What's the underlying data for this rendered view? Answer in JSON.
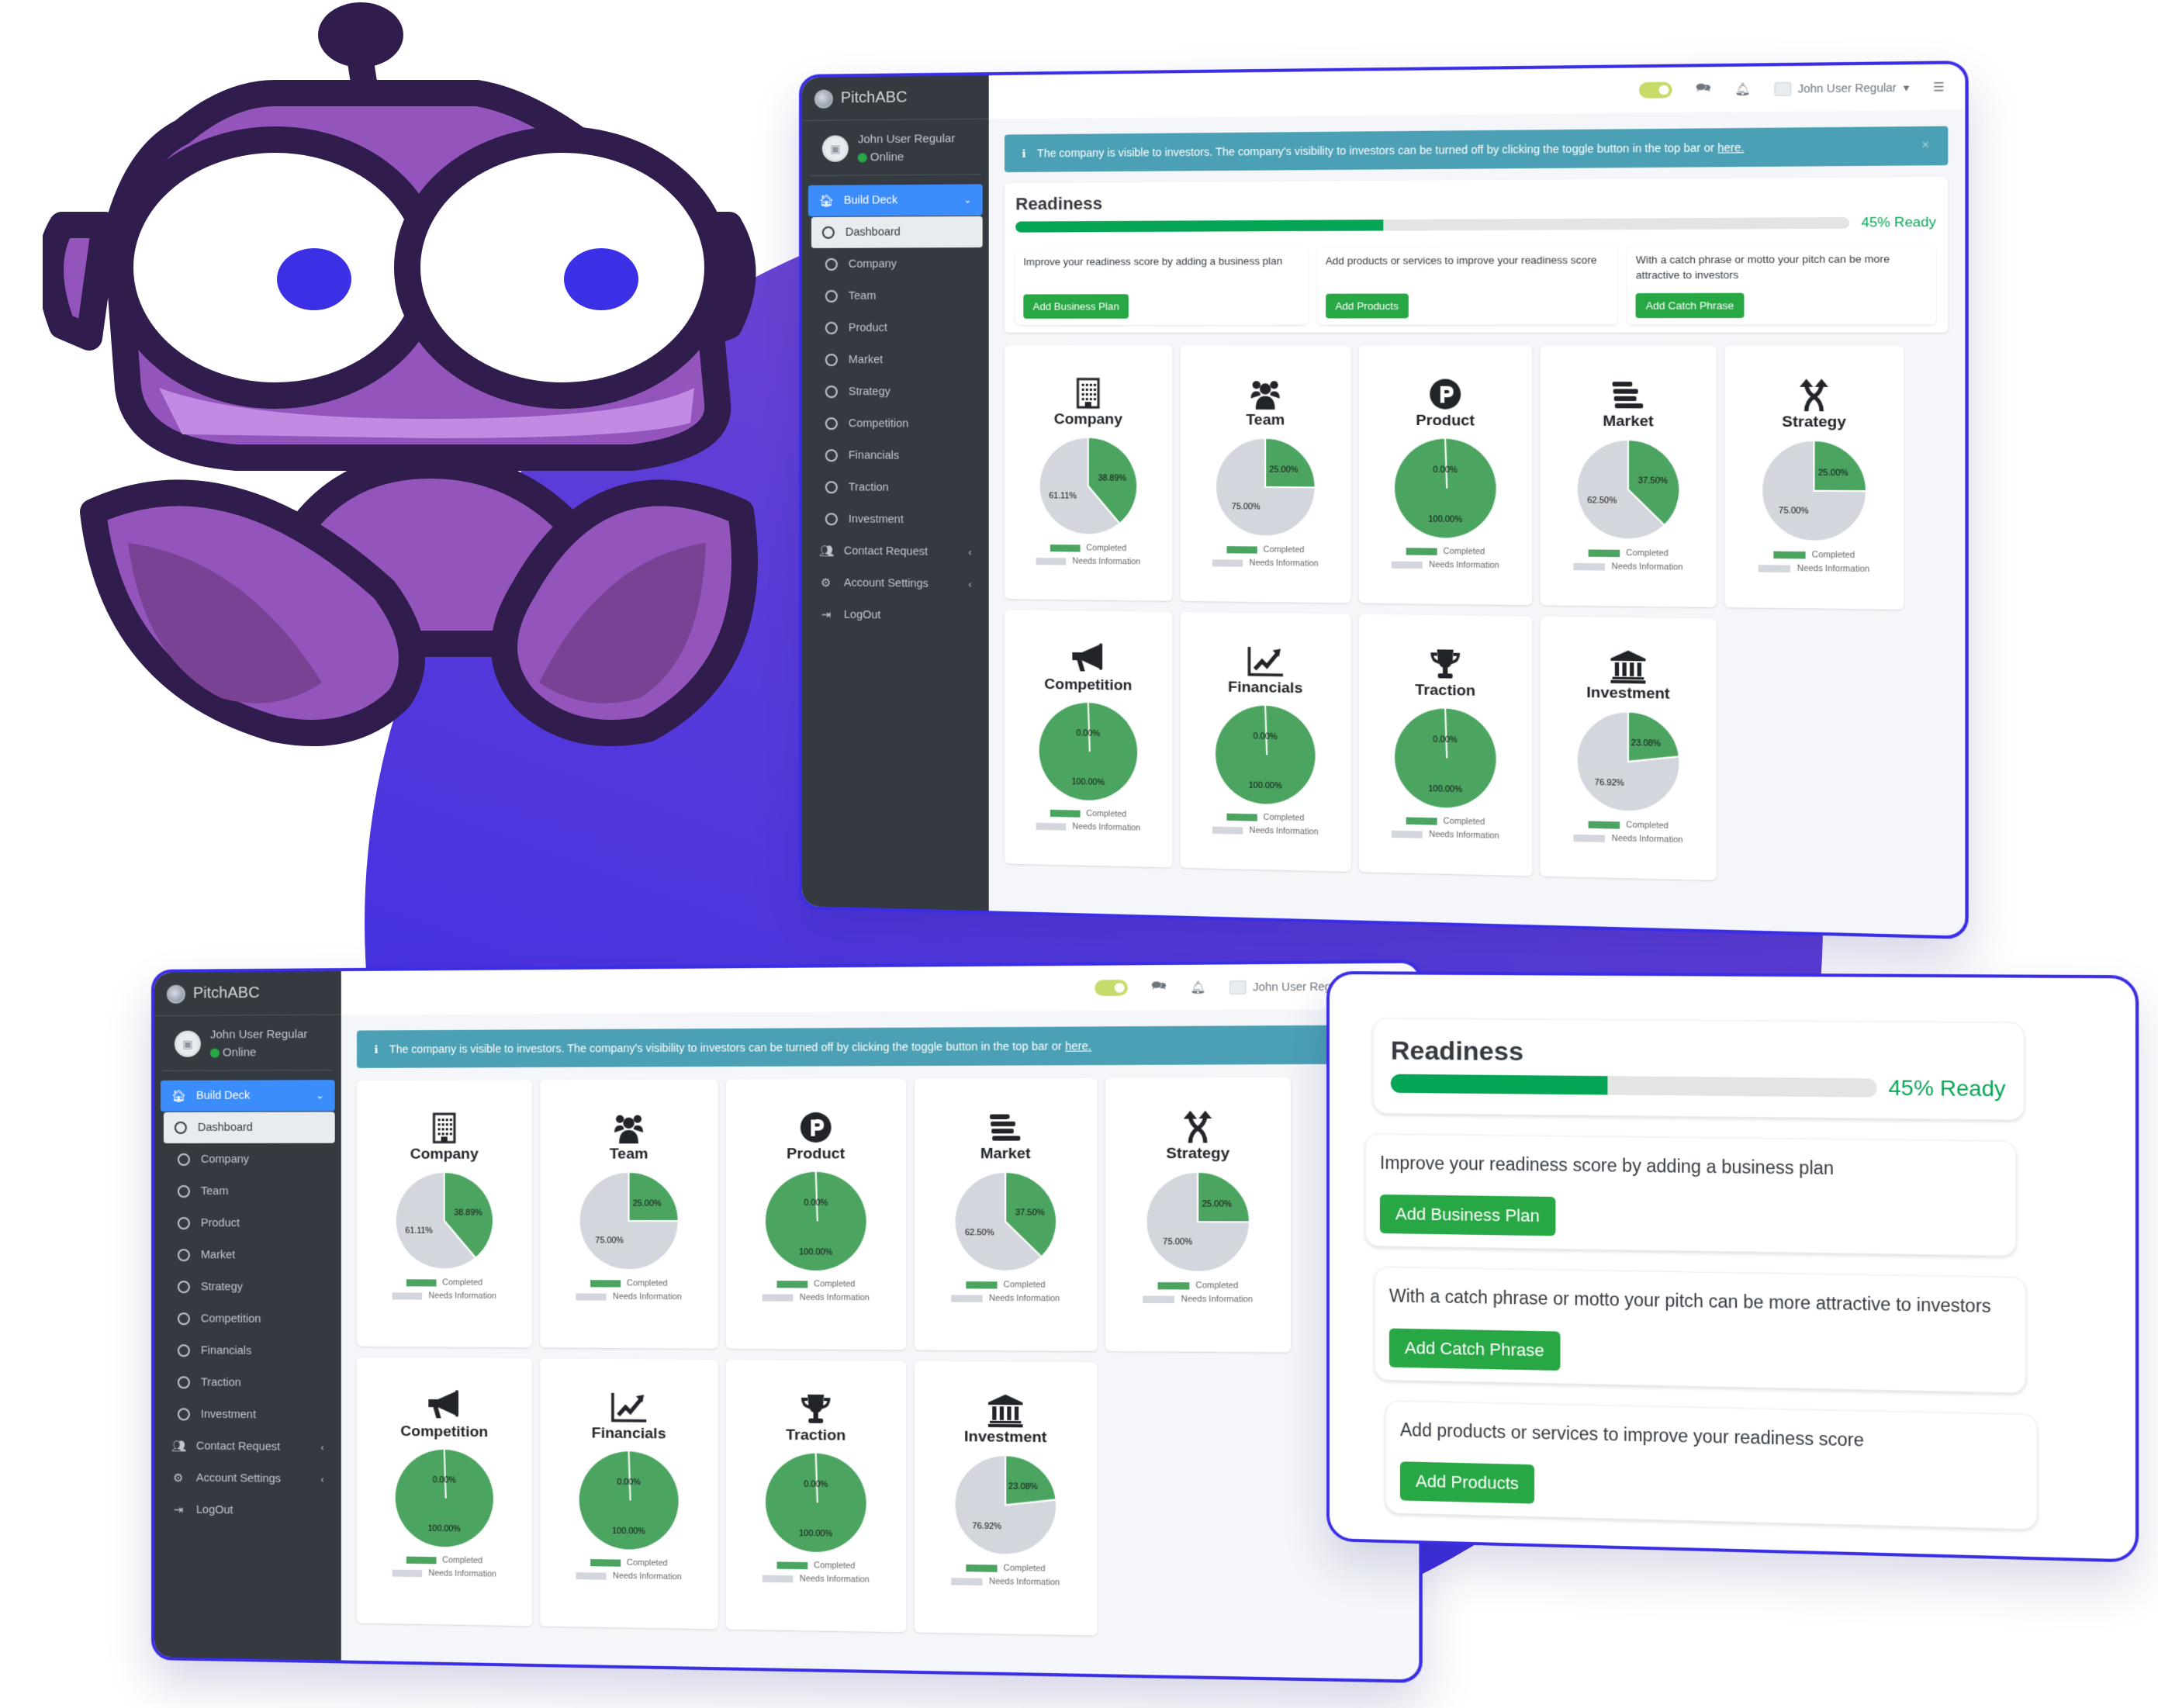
{
  "app": {
    "brand": "PitchABC",
    "user_name": "John User Regular",
    "user_status": "Online"
  },
  "topbar": {
    "visibility_toggle": "on",
    "user_menu_label": "John User Regular",
    "icons": [
      "toggle-switch-icon",
      "chat-icon",
      "bell-icon",
      "user-avatar-icon",
      "caret-down-icon",
      "hamburger-menu-icon"
    ]
  },
  "sidebar": {
    "items": [
      {
        "label": "Build Deck",
        "icon": "home-icon",
        "state": "expanded",
        "chevron": "chevron-down-icon"
      },
      {
        "label": "Dashboard",
        "icon": "circle-icon",
        "state": "current"
      },
      {
        "label": "Company",
        "icon": "circle-icon"
      },
      {
        "label": "Team",
        "icon": "circle-icon"
      },
      {
        "label": "Product",
        "icon": "circle-icon"
      },
      {
        "label": "Market",
        "icon": "circle-icon"
      },
      {
        "label": "Strategy",
        "icon": "circle-icon"
      },
      {
        "label": "Competition",
        "icon": "circle-icon"
      },
      {
        "label": "Financials",
        "icon": "circle-icon"
      },
      {
        "label": "Traction",
        "icon": "circle-icon"
      },
      {
        "label": "Investment",
        "icon": "circle-icon"
      },
      {
        "label": "Contact Request",
        "icon": "users-icon",
        "chevron": "chevron-left-icon"
      },
      {
        "label": "Account Settings",
        "icon": "cogs-icon",
        "chevron": "chevron-left-icon"
      },
      {
        "label": "LogOut",
        "icon": "sign-out-icon"
      }
    ]
  },
  "alert": {
    "icon": "info-icon",
    "text": "The company is visible to investors. The company's visibility to investors can be turned off by clicking the toggle button in the top bar or ",
    "link": "here.",
    "close": "×"
  },
  "readiness": {
    "title": "Readiness",
    "percent": 45,
    "label": "45% Ready",
    "tips": [
      {
        "text": "Improve your readiness score by adding a business plan",
        "button": "Add Business Plan"
      },
      {
        "text": "Add products or services to improve your readiness score",
        "button": "Add Products"
      },
      {
        "text": "With a catch phrase or motto your pitch can be more attractive to investors",
        "button": "Add Catch Phrase"
      }
    ],
    "panel_order": [
      0,
      2,
      1
    ]
  },
  "colors": {
    "completed": "#4ca461",
    "needs_info": "#d3d6dd",
    "accent_blue": "#3c8dfc",
    "success": "#28a745",
    "ready_green": "#06a555",
    "alert_teal": "#4ba0b5",
    "sidebar_dark": "#343a40",
    "frame_purple": "#3a2de6"
  },
  "chart_data": {
    "type": "pie",
    "legend": [
      "Completed",
      "Needs Information"
    ],
    "legend_placement": "bottom",
    "charts": [
      {
        "title": "Company",
        "icon": "building-icon",
        "labels": {
          "completed": "38.89%",
          "needs": "61.11%"
        },
        "fill": {
          "completed": 38.89,
          "needs": 61.11
        }
      },
      {
        "title": "Team",
        "icon": "users-icon",
        "labels": {
          "completed": "25.00%",
          "needs": "75.00%"
        },
        "fill": {
          "completed": 25.0,
          "needs": 75.0
        }
      },
      {
        "title": "Product",
        "icon": "product-hunt-icon",
        "labels": {
          "completed": "0.00%",
          "needs": "100.00%"
        },
        "fill": {
          "completed": 100,
          "needs": 0
        }
      },
      {
        "title": "Market",
        "icon": "bars-icon",
        "labels": {
          "completed": "37.50%",
          "needs": "62.50%"
        },
        "fill": {
          "completed": 37.5,
          "needs": 62.5
        }
      },
      {
        "title": "Strategy",
        "icon": "random-arrows-icon",
        "labels": {
          "completed": "25.00%",
          "needs": "75.00%"
        },
        "fill": {
          "completed": 25.0,
          "needs": 75.0
        }
      },
      {
        "title": "Competition",
        "icon": "bullhorn-icon",
        "labels": {
          "completed": "0.00%",
          "needs": "100.00%"
        },
        "fill": {
          "completed": 100,
          "needs": 0
        }
      },
      {
        "title": "Financials",
        "icon": "chart-line-icon",
        "labels": {
          "completed": "0.00%",
          "needs": "100.00%"
        },
        "fill": {
          "completed": 100,
          "needs": 0
        }
      },
      {
        "title": "Traction",
        "icon": "trophy-icon",
        "labels": {
          "completed": "0.00%",
          "needs": "100.00%"
        },
        "fill": {
          "completed": 100,
          "needs": 0
        }
      },
      {
        "title": "Investment",
        "icon": "bank-icon",
        "labels": {
          "completed": "23.08%",
          "needs": "76.92%"
        },
        "fill": {
          "completed": 23.08,
          "needs": 76.92
        }
      }
    ]
  }
}
